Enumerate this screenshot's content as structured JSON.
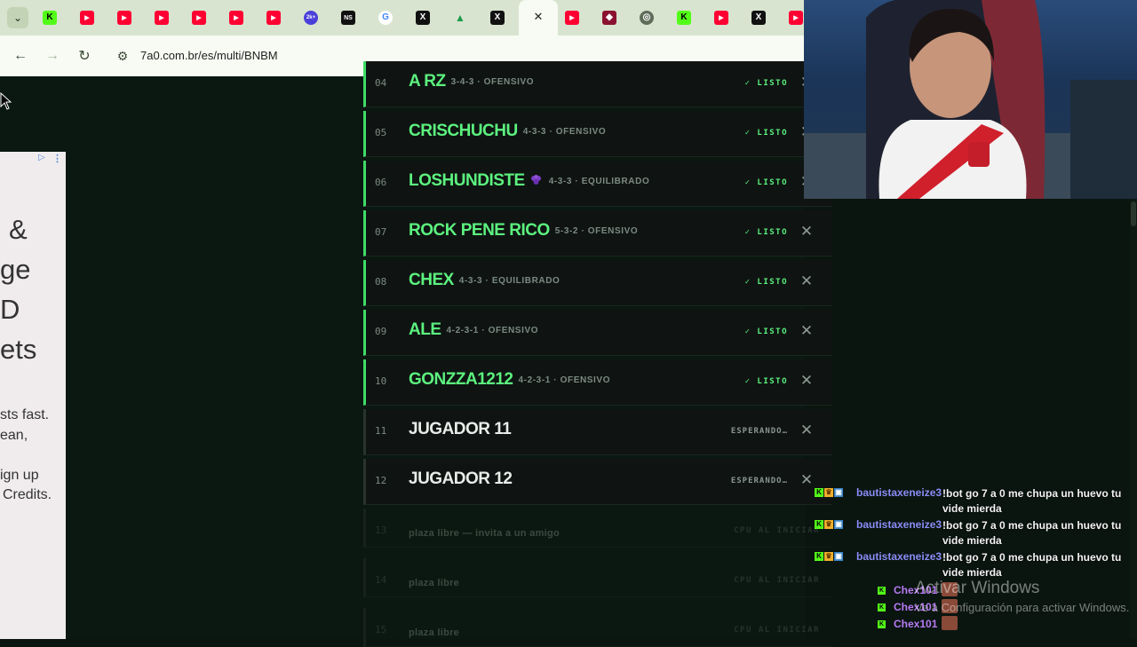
{
  "browser": {
    "tab_menu_icon": "chevron-down-icon",
    "tabs": [
      {
        "icon": "kick-icon",
        "glyph": "K"
      },
      {
        "icon": "youtube-icon",
        "glyph": "▶"
      },
      {
        "icon": "youtube-icon",
        "glyph": "▶"
      },
      {
        "icon": "youtube-icon",
        "glyph": "▶"
      },
      {
        "icon": "youtube-icon",
        "glyph": "▶"
      },
      {
        "icon": "youtube-icon",
        "glyph": "▶"
      },
      {
        "icon": "youtube-icon",
        "glyph": "▶"
      },
      {
        "icon": "2k-icon",
        "glyph": "2k+"
      },
      {
        "icon": "ns-icon",
        "glyph": "NS"
      },
      {
        "icon": "google-icon",
        "glyph": "G"
      },
      {
        "icon": "x-icon",
        "glyph": "X"
      },
      {
        "icon": "drive-icon",
        "glyph": "▲"
      },
      {
        "icon": "x-icon",
        "glyph": "X"
      },
      {
        "icon": "active-tab",
        "glyph": ""
      },
      {
        "icon": "youtube-icon",
        "glyph": "▶"
      },
      {
        "icon": "game-icon",
        "glyph": "◆"
      },
      {
        "icon": "chrome-icon",
        "glyph": "◎"
      },
      {
        "icon": "kick-icon",
        "glyph": "K"
      },
      {
        "icon": "youtube-icon",
        "glyph": "▶"
      },
      {
        "icon": "x-icon",
        "glyph": "X"
      },
      {
        "icon": "youtube-icon",
        "glyph": "▶"
      }
    ],
    "close_glyph": "✕",
    "back_glyph": "←",
    "forward_glyph": "→",
    "reload_glyph": "↻",
    "tune_glyph": "⚙",
    "url": "7a0.com.br/es/multi/BNBM"
  },
  "ad": {
    "badge_glyph": "▷",
    "dots_glyph": "⋮",
    "big_lines": [
      "&",
      "ge",
      "D",
      "ets"
    ],
    "small_lines": [
      "sts fast.",
      "ean,",
      "ign up",
      "Credits."
    ]
  },
  "players": [
    {
      "num": "04",
      "name": "A RZ",
      "tactic": "3-4-3 · OFENSIVO",
      "status": "✓ LISTO",
      "state": "ready",
      "grape": false
    },
    {
      "num": "05",
      "name": "CRISCHUCHU",
      "tactic": "4-3-3 · OFENSIVO",
      "status": "✓ LISTO",
      "state": "ready",
      "grape": false
    },
    {
      "num": "06",
      "name": "LOSHUNDISTE",
      "tactic": "4-3-3 · EQUILIBRADO",
      "status": "✓ LISTO",
      "state": "ready",
      "grape": true
    },
    {
      "num": "07",
      "name": "ROCK PENE RICO",
      "tactic": "5-3-2 · OFENSIVO",
      "status": "✓ LISTO",
      "state": "ready",
      "grape": false
    },
    {
      "num": "08",
      "name": "CHEX",
      "tactic": "4-3-3 · EQUILIBRADO",
      "status": "✓ LISTO",
      "state": "ready",
      "grape": false
    },
    {
      "num": "09",
      "name": "ALE",
      "tactic": "4-2-3-1 · OFENSIVO",
      "status": "✓ LISTO",
      "state": "ready",
      "grape": false
    },
    {
      "num": "10",
      "name": "GONZZA1212",
      "tactic": "4-2-3-1 · OFENSIVO",
      "status": "✓ LISTO",
      "state": "ready",
      "grape": false
    },
    {
      "num": "11",
      "name": "JUGADOR 11",
      "tactic": "",
      "status": "ESPERANDO…",
      "state": "wait",
      "grape": false
    },
    {
      "num": "12",
      "name": "JUGADOR 12",
      "tactic": "",
      "status": "ESPERANDO…",
      "state": "wait",
      "grape": false
    },
    {
      "num": "13",
      "name": "plaza libre — invita a un amigo",
      "tactic": "",
      "status": "CPU AL INICIAR",
      "state": "free",
      "grape": false
    },
    {
      "num": "14",
      "name": "plaza libre",
      "tactic": "",
      "status": "CPU AL INICIAR",
      "state": "free",
      "grape": false
    },
    {
      "num": "15",
      "name": "plaza libre",
      "tactic": "",
      "status": "CPU AL INICIAR",
      "state": "free",
      "grape": false
    }
  ],
  "kick_glyph": "✕",
  "chat": {
    "messages": [
      {
        "user": "bautistaxeneize3",
        "text": "!bot go 7 a 0 me chupa un huevo tu vide mierda"
      },
      {
        "user": "bautistaxeneize3",
        "text": "!bot go 7 a 0 me chupa un huevo tu vide mierda"
      },
      {
        "user": "bautistaxeneize3",
        "text": "!bot go 7 a 0 me chupa un huevo tu vide mierda"
      }
    ],
    "short_messages": [
      "Chex101",
      "Chex101",
      "Chex101"
    ]
  },
  "watermark": {
    "line1": "Activar Windows",
    "line2": "Ve a Configuración para activar Windows."
  }
}
